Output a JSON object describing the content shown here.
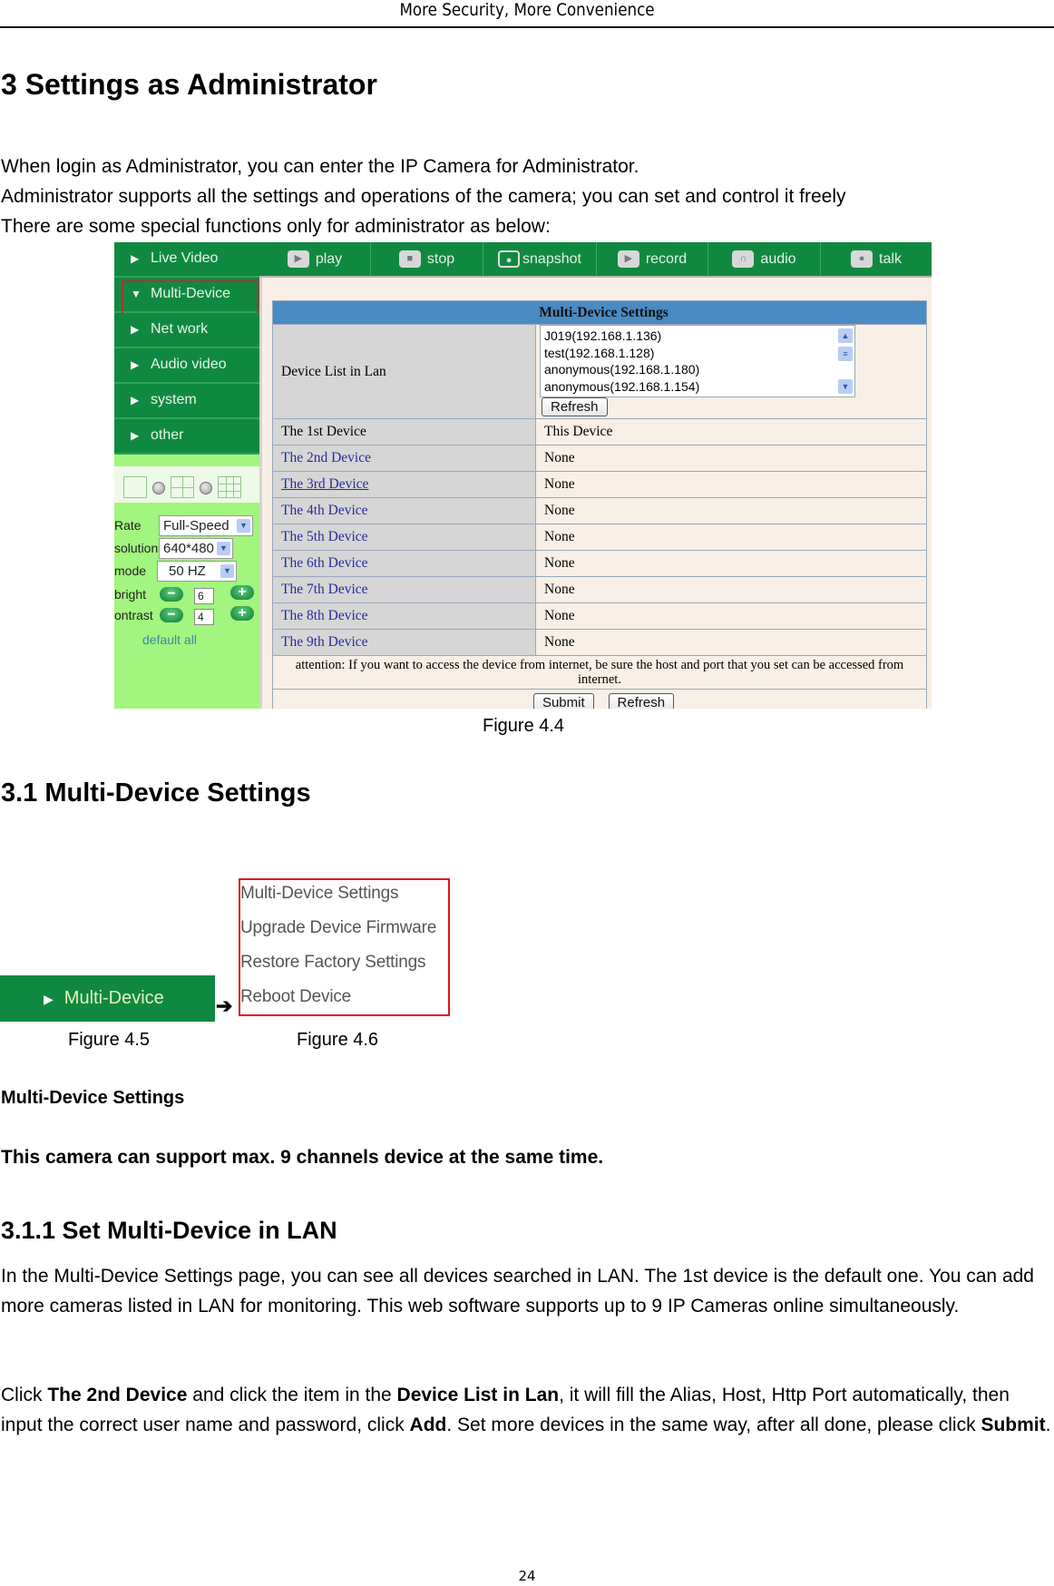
{
  "running_header": "More Security, More Convenience",
  "page_number": "24",
  "section": {
    "title": "3 Settings as Administrator",
    "intro": [
      "When login as Administrator, you can enter the IP Camera for Administrator.",
      "Administrator supports all the settings and operations of the camera; you can set and control it freely",
      "There are some special functions only for administrator as below:"
    ]
  },
  "figure_4_4": {
    "caption": "Figure 4.4",
    "nav": {
      "items": [
        {
          "label": "Live Video",
          "icon": "play-triangle-icon"
        },
        {
          "label": "Multi-Device",
          "icon": "down-triangle-icon",
          "highlighted": true
        },
        {
          "label": "Net work",
          "icon": "play-triangle-icon"
        },
        {
          "label": "Audio video",
          "icon": "play-triangle-icon"
        },
        {
          "label": "system",
          "icon": "play-triangle-icon"
        },
        {
          "label": "other",
          "icon": "play-triangle-icon"
        }
      ],
      "controls": {
        "rate_label": "Rate",
        "rate_value": "Full-Speed",
        "resolution_label": "solution",
        "resolution_value": "640*480",
        "mode_label": "mode",
        "mode_value": "50 HZ",
        "bright_label": "bright",
        "bright_value": "6",
        "contrast_label": "ontrast",
        "contrast_value": "4",
        "default_all": "default all",
        "minus": "−",
        "plus": "+"
      }
    },
    "toolbar": [
      {
        "label": "play",
        "icon": "play-icon"
      },
      {
        "label": "stop",
        "icon": "stop-icon"
      },
      {
        "label": "snapshot",
        "icon": "camera-icon"
      },
      {
        "label": "record",
        "icon": "video-camera-icon"
      },
      {
        "label": "audio",
        "icon": "headphones-icon"
      },
      {
        "label": "talk",
        "icon": "microphone-icon"
      }
    ],
    "settings": {
      "title": "Multi-Device Settings",
      "lan_label": "Device List in Lan",
      "lan_devices": [
        "J019(192.168.1.136)",
        "test(192.168.1.128)",
        "anonymous(192.168.1.180)",
        "anonymous(192.168.1.154)"
      ],
      "refresh_label": "Refresh",
      "devices": [
        {
          "name": "The 1st Device",
          "value": "This Device"
        },
        {
          "name": "The 2nd Device",
          "value": "None"
        },
        {
          "name": "The 3rd Device",
          "value": "None"
        },
        {
          "name": "The 4th Device",
          "value": "None"
        },
        {
          "name": "The 5th Device",
          "value": "None"
        },
        {
          "name": "The 6th Device",
          "value": "None"
        },
        {
          "name": "The 7th Device",
          "value": "None"
        },
        {
          "name": "The 8th Device",
          "value": "None"
        },
        {
          "name": "The 9th Device",
          "value": "None"
        }
      ],
      "attention": "attention: If you want to access the device from internet, be sure the host and port that you set can be accessed from internet.",
      "submit_label": "Submit",
      "refresh2_label": "Refresh"
    }
  },
  "subsection": {
    "title": "3.1 Multi-Device Settings",
    "figure_4_5": {
      "caption": "Figure 4.5",
      "label": "Multi-Device"
    },
    "arrow": "➔",
    "figure_4_6": {
      "caption": "Figure 4.6",
      "menu": [
        "Multi-Device Settings",
        "Upgrade Device Firmware",
        "Restore Factory Settings",
        "Reboot Device"
      ]
    },
    "bold_label": "Multi-Device Settings",
    "support_note": "This camera can support max. 9 channels device at the same time."
  },
  "subsubsection": {
    "title": "3.1.1 Set Multi-Device in LAN",
    "paragraph1": "In the Multi-Device Settings page, you can see all devices searched in LAN. The 1st device is the default one. You can add more cameras listed in LAN for monitoring. This web software supports up to 9 IP Cameras online simultaneously.",
    "paragraph2": {
      "p1": "Click ",
      "b1": "The 2nd Device",
      "p2": " and click the item in the ",
      "b2": "Device List in Lan",
      "p3": ", it will fill the Alias, Host, Http Port automatically, then input the correct user name and password, click ",
      "b3": "Add",
      "p4": ". Set more devices in the same way, after all done, please click ",
      "b4": "Submit",
      "p5": "."
    }
  }
}
